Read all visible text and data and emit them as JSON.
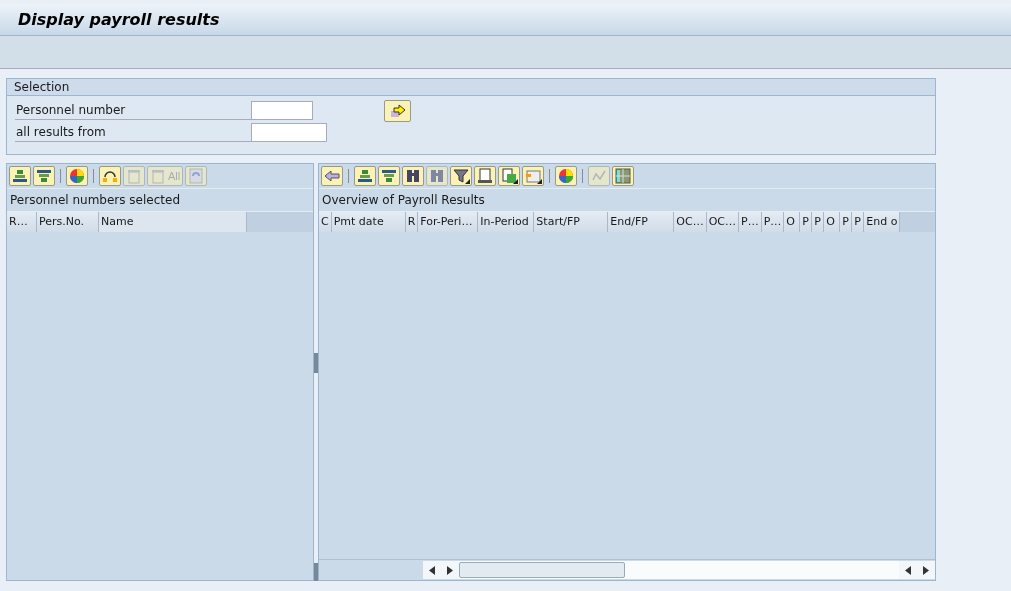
{
  "window": {
    "title": "Display payroll results"
  },
  "selection": {
    "title": "Selection",
    "fields": [
      {
        "label": "Personnel number"
      },
      {
        "label": "all results from"
      }
    ],
    "execute_button": {
      "kind": "execute"
    }
  },
  "left_panel": {
    "toolbar": [
      {
        "kind": "sort-up",
        "disabled": false
      },
      {
        "kind": "sort-down",
        "disabled": false
      },
      {
        "kind": "separator"
      },
      {
        "kind": "color",
        "disabled": false
      },
      {
        "kind": "separator"
      },
      {
        "kind": "select",
        "disabled": false
      },
      {
        "kind": "trash",
        "disabled": true
      },
      {
        "kind": "trash",
        "disabled": true,
        "label": "All"
      },
      {
        "kind": "refresh",
        "disabled": true
      }
    ],
    "title": "Personnel numbers selected",
    "columns": [
      "R…",
      "Pers.No.",
      "Name"
    ]
  },
  "right_panel": {
    "toolbar": [
      {
        "kind": "back",
        "disabled": false
      },
      {
        "kind": "separator"
      },
      {
        "kind": "sort-up",
        "disabled": false
      },
      {
        "kind": "sort-down",
        "disabled": false
      },
      {
        "kind": "find",
        "disabled": false
      },
      {
        "kind": "find-next",
        "disabled": true
      },
      {
        "kind": "filter",
        "disabled": false,
        "dropdown": true
      },
      {
        "kind": "print",
        "disabled": false
      },
      {
        "kind": "export",
        "disabled": false,
        "dropdown": true
      },
      {
        "kind": "layout",
        "disabled": false,
        "dropdown": true
      },
      {
        "kind": "separator"
      },
      {
        "kind": "color",
        "disabled": false
      },
      {
        "kind": "separator"
      },
      {
        "kind": "graphic",
        "disabled": true
      },
      {
        "kind": "grid",
        "disabled": false
      }
    ],
    "title": "Overview of Payroll Results",
    "columns": [
      "C",
      "Pmt date",
      "R",
      "For-Peri…",
      "In-Period",
      "Start/FP",
      "End/FP",
      "OC…",
      "OC…",
      "P…",
      "P…",
      "O",
      "P",
      "P",
      "O",
      "P",
      "P",
      "End o"
    ]
  }
}
